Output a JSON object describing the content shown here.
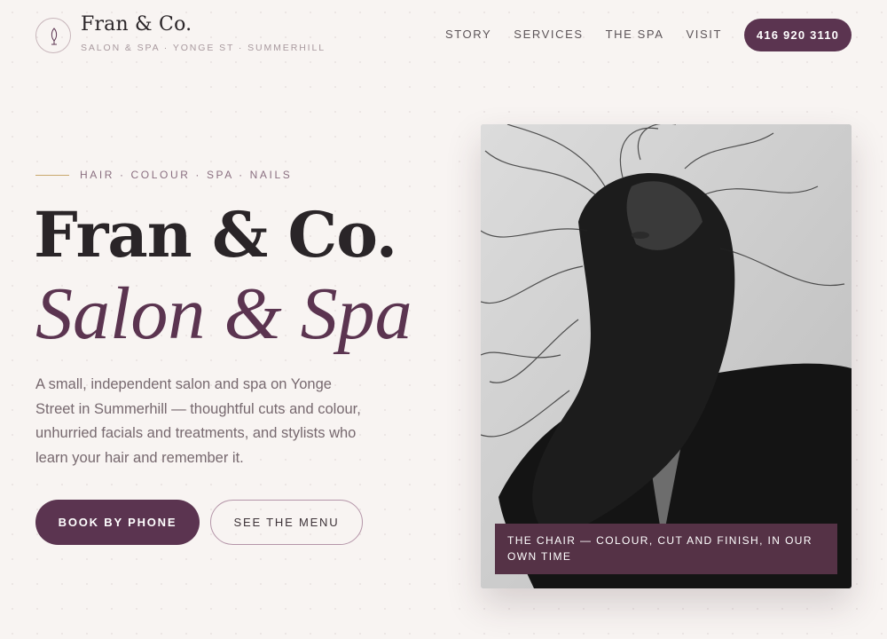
{
  "header": {
    "brand_name": "Fran & Co.",
    "tagline": "SALON & SPA · YONGE ST · SUMMERHILL",
    "logo_icon": "leaf-icon",
    "nav": [
      {
        "label": "STORY"
      },
      {
        "label": "SERVICES"
      },
      {
        "label": "THE SPA"
      },
      {
        "label": "VISIT"
      }
    ],
    "phone_label": "416 920 3110"
  },
  "hero": {
    "eyebrow": "HAIR · COLOUR · SPA · NAILS",
    "title": "Fran & Co.",
    "subtitle": "Salon & Spa",
    "description": "A small, independent salon and spa on Yonge Street in Summerhill — thoughtful cuts and colour, unhurried facials and treatments, and stylists who learn your hair and remember it.",
    "primary_button": "BOOK BY PHONE",
    "secondary_button": "SEE THE MENU"
  },
  "photo": {
    "caption": "THE CHAIR — COLOUR, CUT AND FINISH, IN OUR OWN TIME"
  },
  "colors": {
    "brand_plum": "#5b3450",
    "background": "#f8f4f2",
    "accent_gold": "#c9a96e"
  }
}
